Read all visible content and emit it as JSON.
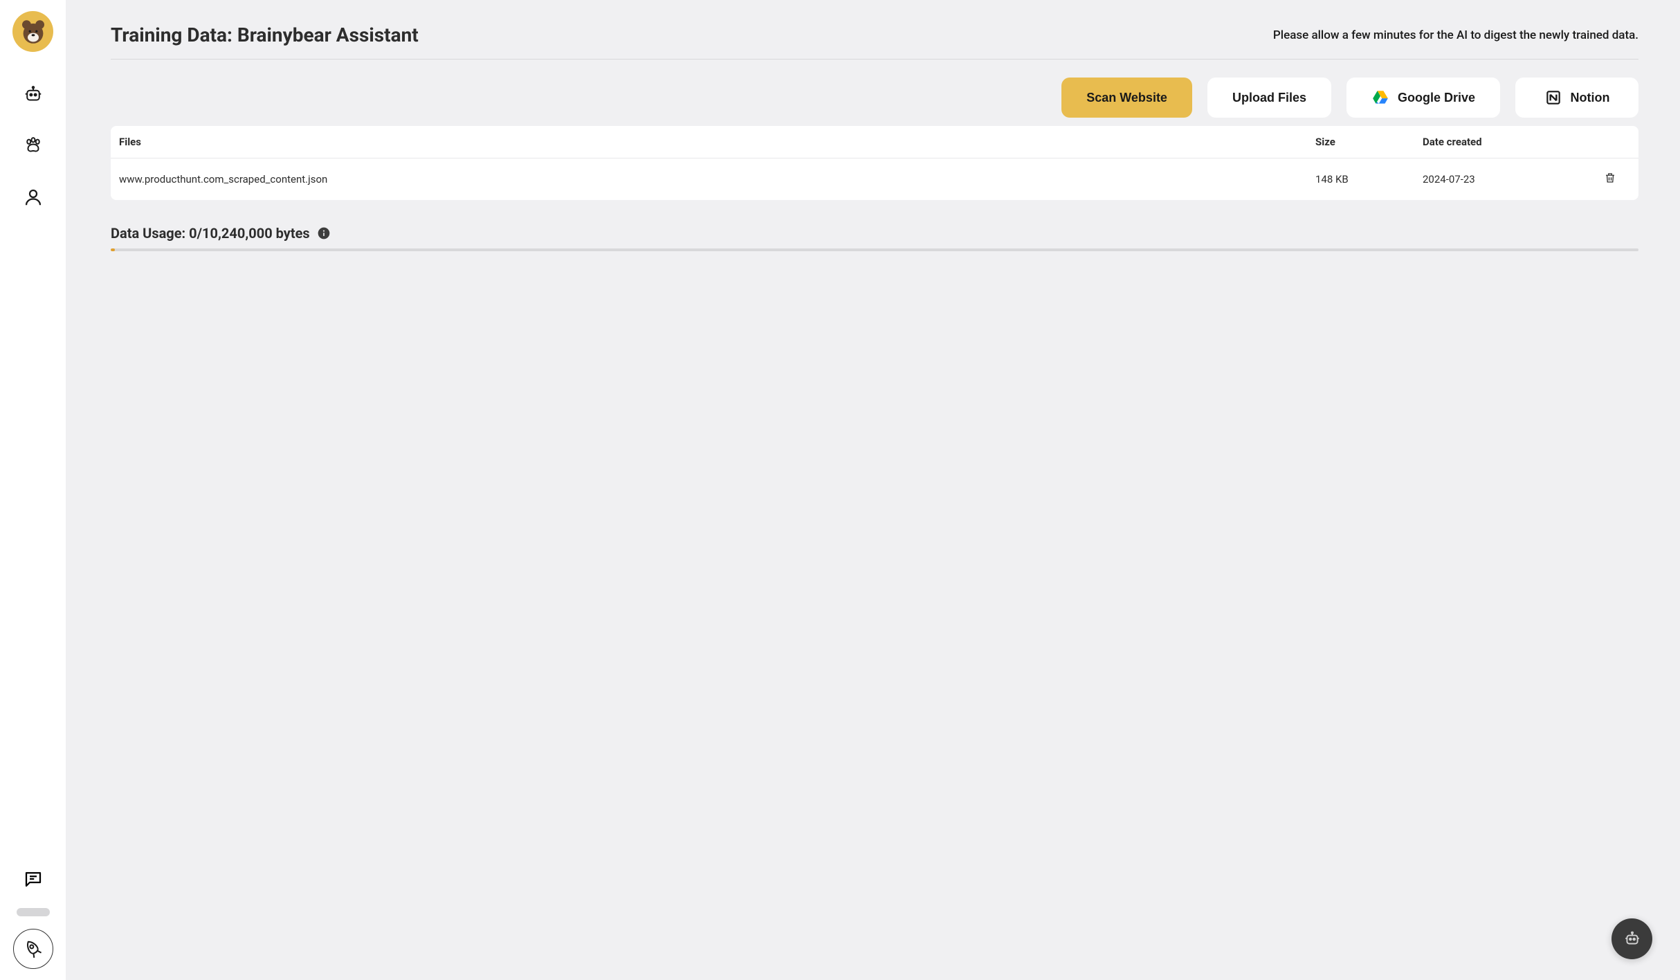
{
  "header": {
    "title": "Training Data: Brainybear Assistant",
    "notice": "Please allow a few minutes for the AI to digest the newly trained data."
  },
  "actions": {
    "scan": "Scan Website",
    "upload": "Upload Files",
    "gdrive": "Google Drive",
    "notion": "Notion"
  },
  "table": {
    "columns": {
      "files": "Files",
      "size": "Size",
      "date": "Date created"
    },
    "rows": [
      {
        "file": "www.producthunt.com_scraped_content.json",
        "size": "148 KB",
        "date": "2024-07-23"
      }
    ]
  },
  "usage": {
    "label": "Data Usage: 0/10,240,000 bytes"
  }
}
